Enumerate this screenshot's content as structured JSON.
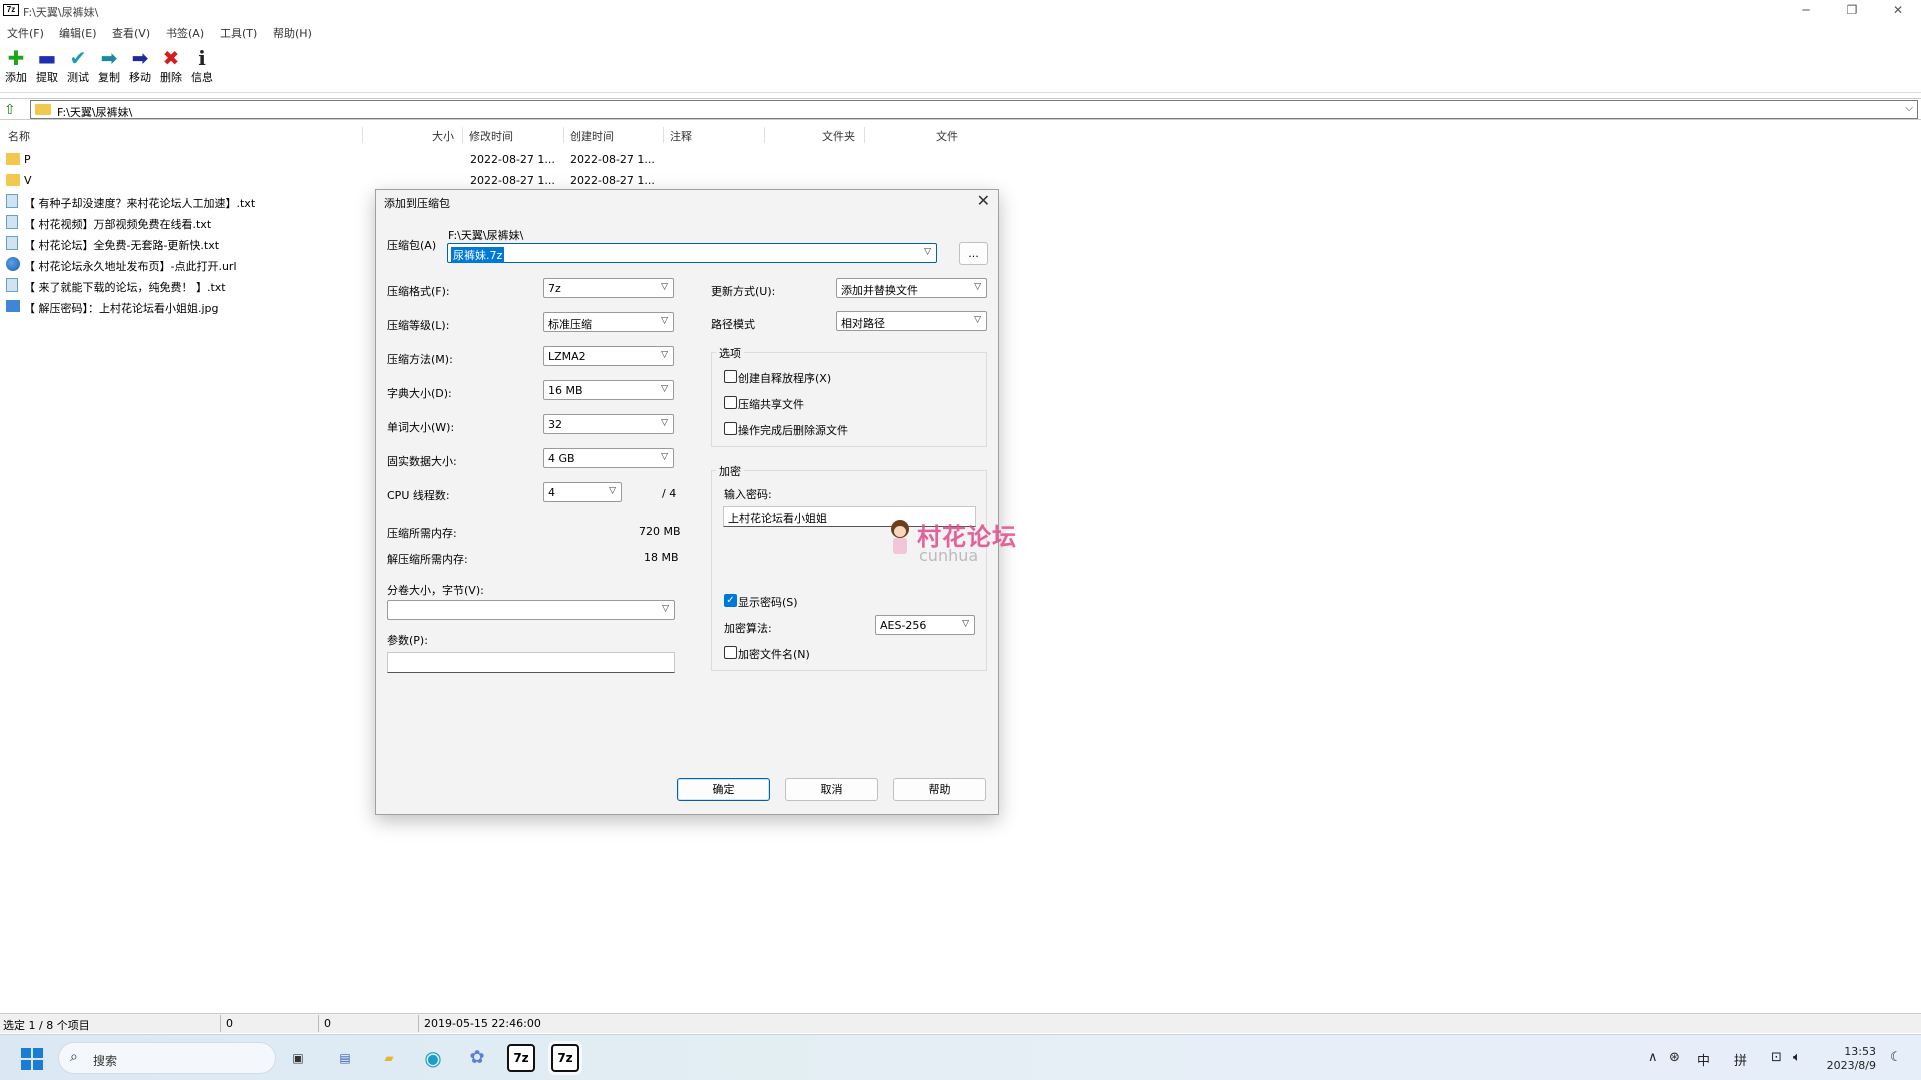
{
  "window": {
    "title": "F:\\天翼\\尿裤妹\\",
    "logo": "7z",
    "min_glyph": "─",
    "max_glyph": "❐",
    "close_glyph": "✕"
  },
  "menu": [
    "文件(F)",
    "编辑(E)",
    "查看(V)",
    "书签(A)",
    "工具(T)",
    "帮助(H)"
  ],
  "toolbar": [
    {
      "label": "添加",
      "icon": "add-icon",
      "glyph": "✚",
      "color": "#1aa51a"
    },
    {
      "label": "提取",
      "icon": "extract-icon",
      "glyph": "▬",
      "color": "#1f2fb0"
    },
    {
      "label": "测试",
      "icon": "test-icon",
      "glyph": "✔",
      "color": "#18a0a8"
    },
    {
      "label": "复制",
      "icon": "copy-icon",
      "glyph": "➡",
      "color": "#178a9c"
    },
    {
      "label": "移动",
      "icon": "move-icon",
      "glyph": "➡",
      "color": "#1e2a9c"
    },
    {
      "label": "删除",
      "icon": "delete-icon",
      "glyph": "✖",
      "color": "#d61d1d"
    },
    {
      "label": "信息",
      "icon": "info-icon",
      "glyph": "i",
      "color": "#222222"
    }
  ],
  "address": {
    "path": "F:\\天翼\\尿裤妹\\",
    "up_glyph": "⇧",
    "drop_glyph": "⌵"
  },
  "columns": {
    "name": "名称",
    "size": "大小",
    "modified": "修改时间",
    "created": "创建时间",
    "comment": "注释",
    "folders": "文件夹",
    "files": "文件"
  },
  "files": [
    {
      "name": "P",
      "type": "folder",
      "modified": "2022-08-27 1...",
      "created": "2022-08-27 1..."
    },
    {
      "name": "V",
      "type": "folder",
      "modified": "2022-08-27 1...",
      "created": "2022-08-27 1..."
    },
    {
      "name": "【 有种子却没速度？来村花论坛人工加速】.txt",
      "type": "txt",
      "modified": "",
      "created": ""
    },
    {
      "name": "【 村花视频】万部视频免费在线看.txt",
      "type": "txt",
      "modified": "",
      "created": ""
    },
    {
      "name": "【 村花论坛】全免费-无套路-更新快.txt",
      "type": "txt",
      "modified": "",
      "created": ""
    },
    {
      "name": "【 村花论坛永久地址发布页】-点此打开.url",
      "type": "url",
      "modified": "",
      "created": ""
    },
    {
      "name": "【 来了就能下载的论坛，纯免费！ 】.txt",
      "type": "txt",
      "modified": "",
      "created": ""
    },
    {
      "name": "【 解压密码】：上村花论坛看小姐姐.jpg",
      "type": "jpg",
      "modified": "",
      "created": ""
    }
  ],
  "dialog": {
    "title": "添加到压缩包",
    "close_glyph": "✕",
    "archive_label": "压缩包(A)",
    "archive_path": "F:\\天翼\\尿裤妹\\",
    "archive_name": "尿裤妹.7z",
    "browse": "...",
    "left": {
      "format": {
        "label": "压缩格式(F):",
        "value": "7z"
      },
      "level": {
        "label": "压缩等级(L):",
        "value": "标准压缩"
      },
      "method": {
        "label": "压缩方法(M):",
        "value": "LZMA2"
      },
      "dict": {
        "label": "字典大小(D):",
        "value": "16 MB"
      },
      "word": {
        "label": "单词大小(W):",
        "value": "32"
      },
      "solid": {
        "label": "固实数据大小:",
        "value": "4 GB"
      },
      "threads": {
        "label": "CPU 线程数:",
        "value": "4",
        "max": "/ 4"
      },
      "mem_comp": {
        "label": "压缩所需内存:",
        "value": "720 MB"
      },
      "mem_decomp": {
        "label": "解压缩所需内存:",
        "value": "18 MB"
      },
      "volume": {
        "label": "分卷大小，字节(V):",
        "value": ""
      },
      "params": {
        "label": "参数(P):",
        "value": ""
      }
    },
    "right": {
      "update": {
        "label": "更新方式(U):",
        "value": "添加并替换文件"
      },
      "pathmode": {
        "label": "路径模式",
        "value": "相对路径"
      },
      "options_title": "选项",
      "options": [
        {
          "label": "创建自释放程序(X)",
          "checked": false
        },
        {
          "label": "压缩共享文件",
          "checked": false
        },
        {
          "label": "操作完成后删除源文件",
          "checked": false
        }
      ],
      "encryption_title": "加密",
      "password_label": "输入密码:",
      "password_value": "上村花论坛看小姐姐",
      "show_password": {
        "label": "显示密码(S)",
        "checked": true
      },
      "method": {
        "label": "加密算法:",
        "value": "AES-256"
      },
      "encrypt_names": {
        "label": "加密文件名(N)",
        "checked": false
      }
    },
    "buttons": {
      "ok": "确定",
      "cancel": "取消",
      "help": "帮助"
    }
  },
  "watermark": {
    "text": "村花论坛",
    "sub": "cunhua"
  },
  "status": {
    "selection": "选定 1 / 8 个项目",
    "size1": "0",
    "size2": "0",
    "datetime": "2019-05-15 22:46:00"
  },
  "taskbar": {
    "search_placeholder": "搜索",
    "search_glyph": "⌕",
    "apps": [
      {
        "icon": "task-view-icon",
        "glyph": "▣",
        "color": "#333333"
      },
      {
        "icon": "store-icon",
        "glyph": "▤",
        "color": "#3a5fb0"
      },
      {
        "icon": "file-explorer-icon",
        "glyph": "▰",
        "color": "#e8b42a"
      },
      {
        "icon": "edge-icon",
        "glyph": "◉",
        "color": "#1a9ec7"
      },
      {
        "icon": "copilot-icon",
        "glyph": "✿",
        "color": "#5a7fd8"
      },
      {
        "icon": "7zip-icon",
        "glyph": "7z",
        "color": "#111111"
      },
      {
        "icon": "7zip-icon-active",
        "glyph": "7z",
        "color": "#111111"
      }
    ],
    "tray": [
      {
        "icon": "chevron-up-icon",
        "glyph": "∧"
      },
      {
        "icon": "network-shield-icon",
        "glyph": "⊛"
      },
      {
        "icon": "ime-mode-icon",
        "glyph": "中"
      },
      {
        "icon": "ime-pinyin-icon",
        "glyph": "拼"
      },
      {
        "icon": "display-icon",
        "glyph": "⊡"
      },
      {
        "icon": "volume-icon",
        "glyph": "🔈︎"
      }
    ],
    "time": "13:53",
    "date": "2023/8/9",
    "notification_glyph": "☾"
  }
}
